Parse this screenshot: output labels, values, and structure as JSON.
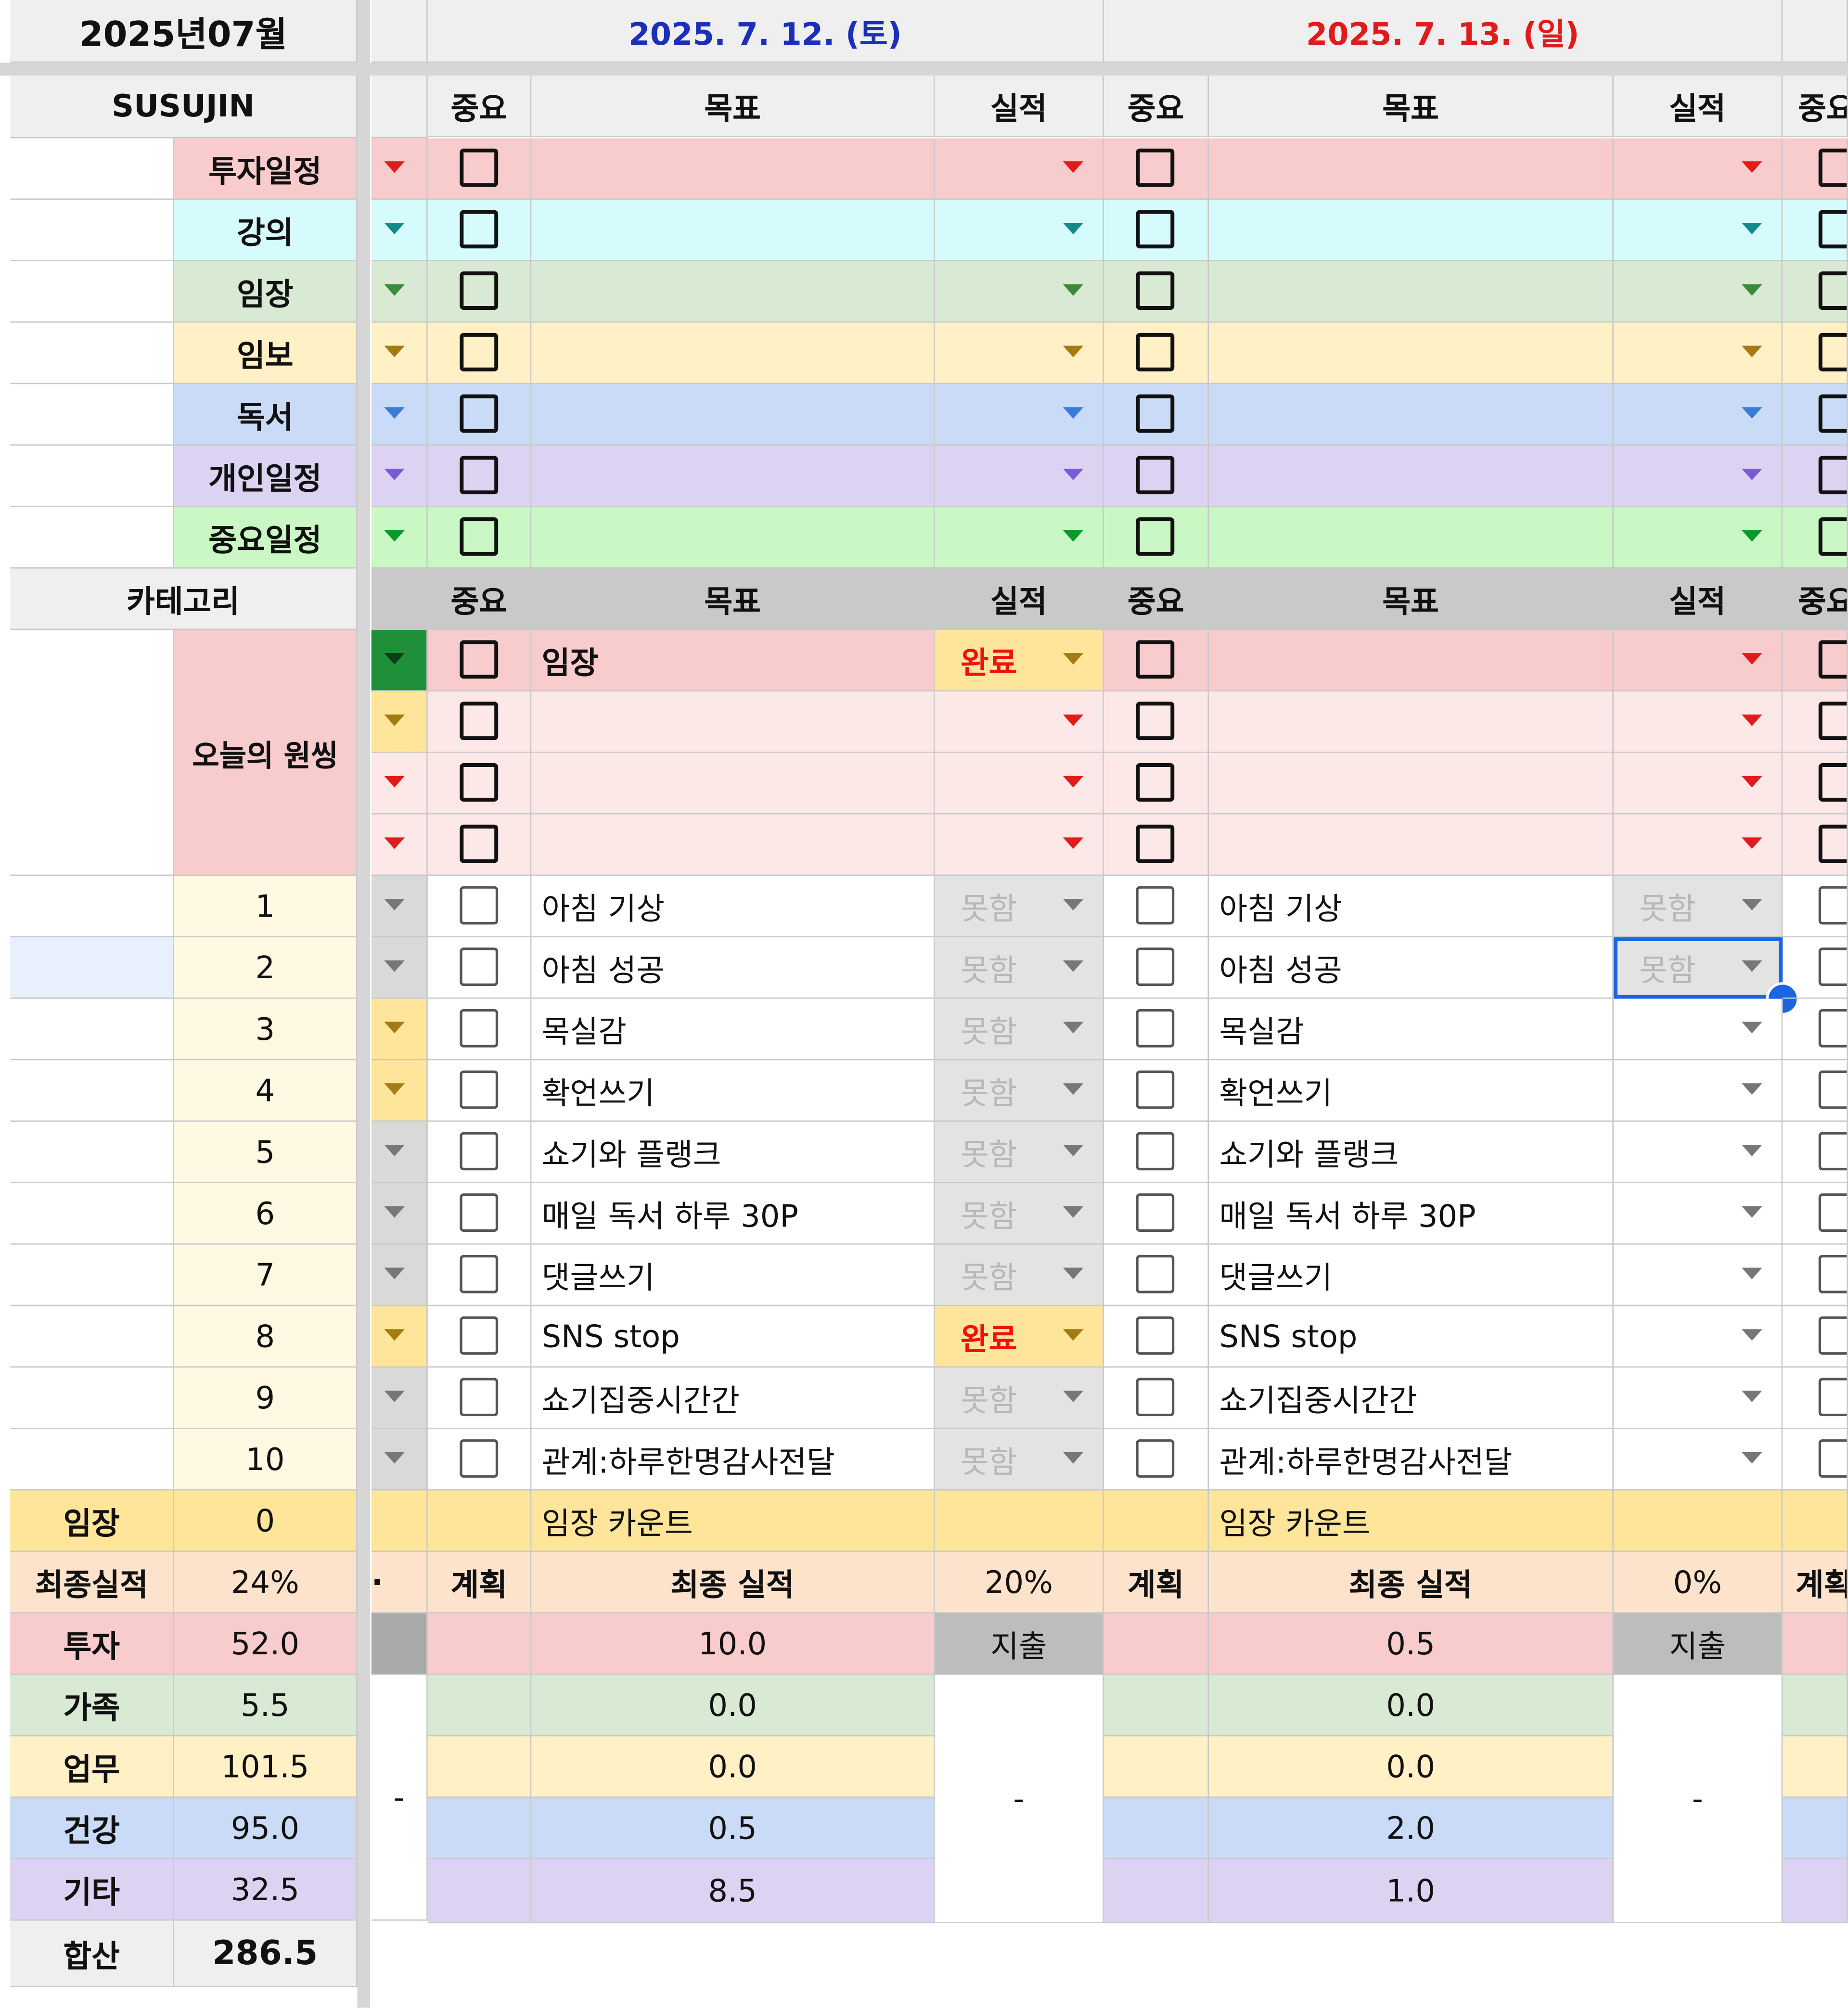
{
  "sheet": {
    "month_title": "2025년07월",
    "owner": "SUSUJIN",
    "category_label": "카테고리",
    "wonsing_label": "오늘의 원씽",
    "colors": {
      "red_bg": "#f8cbcc",
      "light_red_bg": "#fde8e8",
      "cyan_bg": "#d6fbfd",
      "green_bg": "#d8ead3",
      "yellow_bg": "#fff0c6",
      "blue_bg": "#c9dbf7",
      "purple_bg": "#dcd3f3",
      "mint_bg": "#caf8c5",
      "orange_bg": "#fde3cc",
      "gold_bg": "#ffe599",
      "blue_text": "#1b2fb8",
      "red_text": "#e11b1b",
      "active_blue": "#1a66e0"
    },
    "schedule_types": [
      {
        "label": "투자일정",
        "arrow_color": "#e11b1b"
      },
      {
        "label": "강의",
        "arrow_color": "#138a8a"
      },
      {
        "label": "임장",
        "arrow_color": "#3a8a3a"
      },
      {
        "label": "임보",
        "arrow_color": "#a47a12"
      },
      {
        "label": "독서",
        "arrow_color": "#3a7dd8"
      },
      {
        "label": "개인일정",
        "arrow_color": "#7a5ad8"
      },
      {
        "label": "중요일정",
        "arrow_color": "#0a9a2a"
      }
    ],
    "habit_numbers": [
      "1",
      "2",
      "3",
      "4",
      "5",
      "6",
      "7",
      "8",
      "9",
      "10"
    ],
    "summary": [
      {
        "label": "임장",
        "value": "0"
      },
      {
        "label": "최종실적",
        "value": "24%"
      },
      {
        "label": "투자",
        "value": "52.0"
      },
      {
        "label": "가족",
        "value": "5.5"
      },
      {
        "label": "업무",
        "value": "101.5"
      },
      {
        "label": "건강",
        "value": "95.0"
      },
      {
        "label": "기타",
        "value": "32.5"
      },
      {
        "label": "합산",
        "value": "286.5"
      }
    ],
    "dash": "-",
    "partial_char": "·"
  },
  "columns": {
    "important": "중요",
    "goal": "목표",
    "result": "실적",
    "plan": "계획",
    "final_result": "최종 실적",
    "spend": "지출",
    "visit_count": "임장 카운트"
  },
  "days": [
    {
      "date": "2025. 7. 12. (토)",
      "date_color": "#1b2fb8",
      "wonsing": [
        {
          "goal": "임장",
          "result": "완료"
        },
        {
          "goal": "",
          "result": ""
        },
        {
          "goal": "",
          "result": ""
        },
        {
          "goal": "",
          "result": ""
        }
      ],
      "habits": [
        {
          "goal": "아침 기상",
          "result": "못함"
        },
        {
          "goal": "아침 성공",
          "result": "못함"
        },
        {
          "goal": "목실감",
          "result": "못함"
        },
        {
          "goal": "확언쓰기",
          "result": "못함"
        },
        {
          "goal": "쇼기와 플랭크",
          "result": "못함"
        },
        {
          "goal": "매일 독서 하루 30P",
          "result": "못함"
        },
        {
          "goal": "댓글쓰기",
          "result": "못함"
        },
        {
          "goal": "SNS stop",
          "result": "완료"
        },
        {
          "goal": "쇼기집중시간간",
          "result": "못함"
        },
        {
          "goal": "관계:하루한명감사전달",
          "result": "못함"
        }
      ],
      "final_percent": "20%",
      "spend_values": [
        "10.0",
        "0.0",
        "0.0",
        "0.5",
        "8.5"
      ]
    },
    {
      "date": "2025. 7. 13. (일)",
      "date_color": "#e11b1b",
      "wonsing": [
        {
          "goal": "",
          "result": ""
        },
        {
          "goal": "",
          "result": ""
        },
        {
          "goal": "",
          "result": ""
        },
        {
          "goal": "",
          "result": ""
        }
      ],
      "habits": [
        {
          "goal": "아침 기상",
          "result": "못함"
        },
        {
          "goal": "아침 성공",
          "result": "못함"
        },
        {
          "goal": "목실감",
          "result": ""
        },
        {
          "goal": "확언쓰기",
          "result": ""
        },
        {
          "goal": "쇼기와 플랭크",
          "result": ""
        },
        {
          "goal": "매일 독서 하루 30P",
          "result": ""
        },
        {
          "goal": "댓글쓰기",
          "result": ""
        },
        {
          "goal": "SNS stop",
          "result": ""
        },
        {
          "goal": "쇼기집중시간간",
          "result": ""
        },
        {
          "goal": "관계:하루한명감사전달",
          "result": ""
        }
      ],
      "final_percent": "0%",
      "spend_values": [
        "0.5",
        "0.0",
        "0.0",
        "2.0",
        "1.0"
      ]
    }
  ],
  "partial_column": {
    "important_cut": "중요",
    "plan_cut": "계획"
  },
  "selection": {
    "day": 2,
    "row": 2
  }
}
